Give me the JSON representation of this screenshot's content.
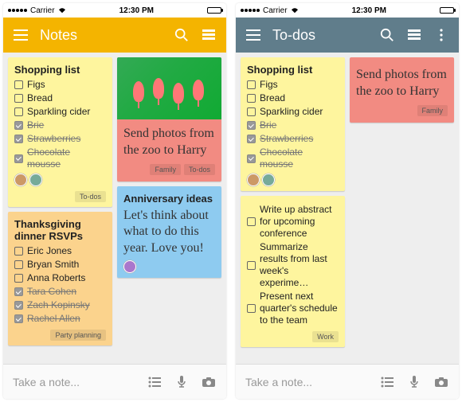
{
  "status": {
    "carrier": "Carrier",
    "time": "12:30 PM"
  },
  "left": {
    "appbar": {
      "title": "Notes",
      "bg": "#f4b400"
    },
    "shopping": {
      "title": "Shopping list",
      "items": [
        {
          "label": "Figs",
          "done": false
        },
        {
          "label": "Bread",
          "done": false
        },
        {
          "label": "Sparkling cider",
          "done": false
        },
        {
          "label": "Brie",
          "done": true
        },
        {
          "label": "Strawberries",
          "done": true
        },
        {
          "label": "Chocolate mousse",
          "done": true
        }
      ],
      "tag": "To-dos"
    },
    "rsvps": {
      "title": "Thanksgiving dinner RSVPs",
      "items": [
        {
          "label": "Eric Jones",
          "done": false
        },
        {
          "label": "Bryan Smith",
          "done": false
        },
        {
          "label": "Anna Roberts",
          "done": false
        },
        {
          "label": "Tara Cohen",
          "done": true
        },
        {
          "label": "Zach Kopinsky",
          "done": true
        },
        {
          "label": "Rachel Allen",
          "done": true
        }
      ],
      "tag": "Party planning"
    },
    "zoo": {
      "body": "Send photos from the zoo to Harry",
      "tag1": "Family",
      "tag2": "To-dos"
    },
    "anniv": {
      "title": "Anniversary ideas",
      "body": "Let's think about what to do this year. Love you!"
    }
  },
  "right": {
    "appbar": {
      "title": "To-dos",
      "bg": "#607d8b"
    },
    "shopping": {
      "title": "Shopping list",
      "items": [
        {
          "label": "Figs",
          "done": false
        },
        {
          "label": "Bread",
          "done": false
        },
        {
          "label": "Sparkling cider",
          "done": false
        },
        {
          "label": "Brie",
          "done": true
        },
        {
          "label": "Strawberries",
          "done": true
        },
        {
          "label": "Chocolate mousse",
          "done": true
        }
      ]
    },
    "zoo": {
      "body": "Send photos from the zoo to Harry",
      "tag": "Family"
    },
    "work": {
      "items": [
        {
          "label": "Write up abstract for upcoming conference",
          "done": false
        },
        {
          "label": "Summarize results from last week's experime…",
          "done": false
        },
        {
          "label": "Present next quarter's schedule to the team",
          "done": false
        }
      ],
      "tag": "Work"
    }
  },
  "bottom": {
    "placeholder": "Take a note..."
  }
}
